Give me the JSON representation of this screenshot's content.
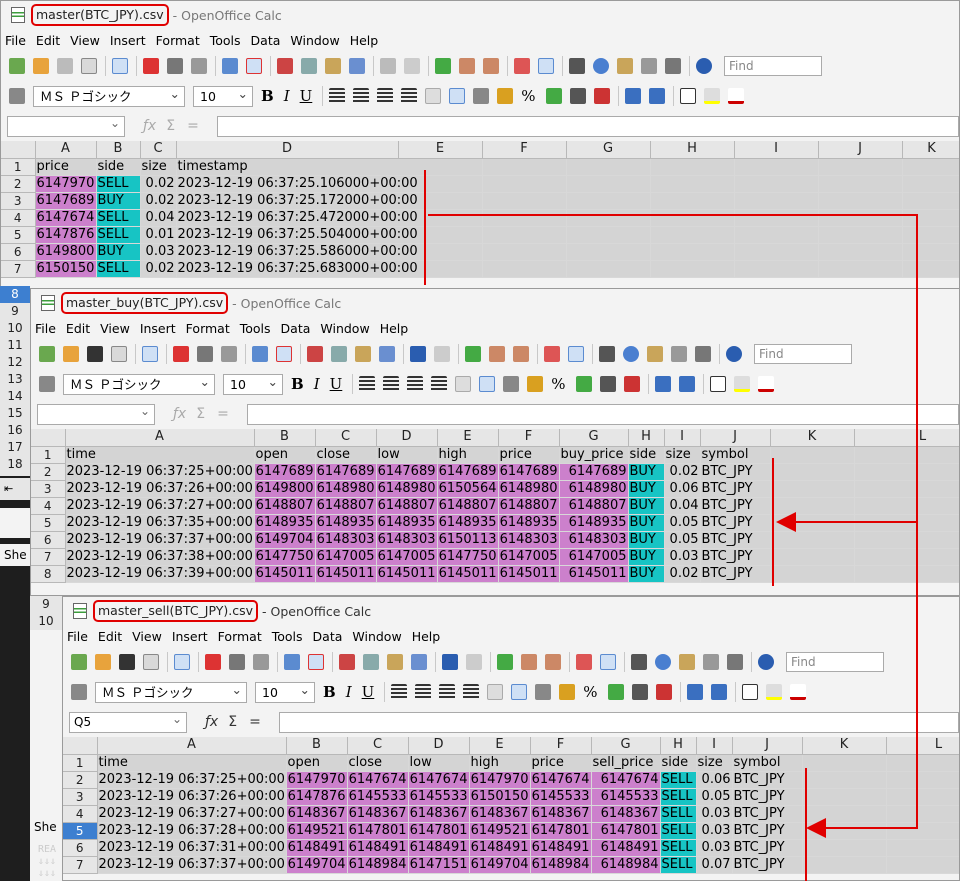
{
  "menu": [
    "File",
    "Edit",
    "View",
    "Insert",
    "Format",
    "Tools",
    "Data",
    "Window",
    "Help"
  ],
  "find_placeholder": "Find",
  "font_name": "ＭＳ Ｐゴシック",
  "font_size": "10",
  "fmt": {
    "bold": "B",
    "italic": "I",
    "underline": "U",
    "percent": "%"
  },
  "formula": {
    "fx": "ƒx",
    "sigma": "Σ",
    "equals": "="
  },
  "windows": {
    "master": {
      "filename": "master(BTC_JPY).csv",
      "app": "- OpenOffice Calc",
      "namebox": "",
      "columns": [
        "A",
        "B",
        "C",
        "D",
        "E",
        "F",
        "G",
        "H",
        "I",
        "J",
        "K"
      ],
      "header_row": [
        "price",
        "side",
        "size",
        "timestamp"
      ],
      "rows": [
        [
          "6147970",
          "SELL",
          "0.02",
          "2023-12-19 06:37:25.106000+00:00"
        ],
        [
          "6147689",
          "BUY",
          "0.02",
          "2023-12-19 06:37:25.172000+00:00"
        ],
        [
          "6147674",
          "SELL",
          "0.04",
          "2023-12-19 06:37:25.472000+00:00"
        ],
        [
          "6147876",
          "SELL",
          "0.01",
          "2023-12-19 06:37:25.504000+00:00"
        ],
        [
          "6149800",
          "BUY",
          "0.03",
          "2023-12-19 06:37:25.586000+00:00"
        ],
        [
          "6150150",
          "SELL",
          "0.02",
          "2023-12-19 06:37:25.683000+00:00"
        ]
      ],
      "row_numbers": [
        "1",
        "2",
        "3",
        "4",
        "5",
        "6",
        "7",
        "8",
        "9",
        "10",
        "11",
        "12",
        "13",
        "14",
        "15",
        "16",
        "17",
        "18"
      ]
    },
    "buy": {
      "filename": "master_buy(BTC_JPY).csv",
      "app": "- OpenOffice Calc",
      "namebox": "",
      "columns": [
        "A",
        "B",
        "C",
        "D",
        "E",
        "F",
        "G",
        "H",
        "I",
        "J",
        "K",
        "L"
      ],
      "header_row": [
        "time",
        "open",
        "close",
        "low",
        "high",
        "price",
        "buy_price",
        "side",
        "size",
        "symbol"
      ],
      "rows": [
        [
          "2023-12-19 06:37:25+00:00",
          "6147689",
          "6147689",
          "6147689",
          "6147689",
          "6147689",
          "6147689",
          "BUY",
          "0.02",
          "BTC_JPY"
        ],
        [
          "2023-12-19 06:37:26+00:00",
          "6149800",
          "6148980",
          "6148980",
          "6150564",
          "6148980",
          "6148980",
          "BUY",
          "0.06",
          "BTC_JPY"
        ],
        [
          "2023-12-19 06:37:27+00:00",
          "6148807",
          "6148807",
          "6148807",
          "6148807",
          "6148807",
          "6148807",
          "BUY",
          "0.04",
          "BTC_JPY"
        ],
        [
          "2023-12-19 06:37:35+00:00",
          "6148935",
          "6148935",
          "6148935",
          "6148935",
          "6148935",
          "6148935",
          "BUY",
          "0.05",
          "BTC_JPY"
        ],
        [
          "2023-12-19 06:37:37+00:00",
          "6149704",
          "6148303",
          "6148303",
          "6150113",
          "6148303",
          "6148303",
          "BUY",
          "0.05",
          "BTC_JPY"
        ],
        [
          "2023-12-19 06:37:38+00:00",
          "6147750",
          "6147005",
          "6147005",
          "6147750",
          "6147005",
          "6147005",
          "BUY",
          "0.03",
          "BTC_JPY"
        ],
        [
          "2023-12-19 06:37:39+00:00",
          "6145011",
          "6145011",
          "6145011",
          "6145011",
          "6145011",
          "6145011",
          "BUY",
          "0.02",
          "BTC_JPY"
        ]
      ]
    },
    "sell": {
      "filename": "master_sell(BTC_JPY).csv",
      "app": "- OpenOffice Calc",
      "namebox": "Q5",
      "columns": [
        "A",
        "B",
        "C",
        "D",
        "E",
        "F",
        "G",
        "H",
        "I",
        "J",
        "K",
        "L"
      ],
      "header_row": [
        "time",
        "open",
        "close",
        "low",
        "high",
        "price",
        "sell_price",
        "side",
        "size",
        "symbol"
      ],
      "rows": [
        [
          "2023-12-19 06:37:25+00:00",
          "6147970",
          "6147674",
          "6147674",
          "6147970",
          "6147674",
          "6147674",
          "SELL",
          "0.06",
          "BTC_JPY"
        ],
        [
          "2023-12-19 06:37:26+00:00",
          "6147876",
          "6145533",
          "6145533",
          "6150150",
          "6145533",
          "6145533",
          "SELL",
          "0.05",
          "BTC_JPY"
        ],
        [
          "2023-12-19 06:37:27+00:00",
          "6148367",
          "6148367",
          "6148367",
          "6148367",
          "6148367",
          "6148367",
          "SELL",
          "0.03",
          "BTC_JPY"
        ],
        [
          "2023-12-19 06:37:28+00:00",
          "6149521",
          "6147801",
          "6147801",
          "6149521",
          "6147801",
          "6147801",
          "SELL",
          "0.03",
          "BTC_JPY"
        ],
        [
          "2023-12-19 06:37:31+00:00",
          "6148491",
          "6148491",
          "6148491",
          "6148491",
          "6148491",
          "6148491",
          "SELL",
          "0.03",
          "BTC_JPY"
        ],
        [
          "2023-12-19 06:37:37+00:00",
          "6149704",
          "6148984",
          "6147151",
          "6149704",
          "6148984",
          "6148984",
          "SELL",
          "0.07",
          "BTC_JPY"
        ]
      ]
    }
  },
  "behind_labels": {
    "tab": "She",
    "tab2": "She",
    "terminal": [
      "REA",
      "⇓⇓⇓",
      "⇓⇓⇓"
    ]
  },
  "colors": {
    "highlight_magenta": "#cc80cc",
    "highlight_cyan": "#17c4c4",
    "annotation_red": "#e00000",
    "selected_row": "#3d7fd0"
  }
}
